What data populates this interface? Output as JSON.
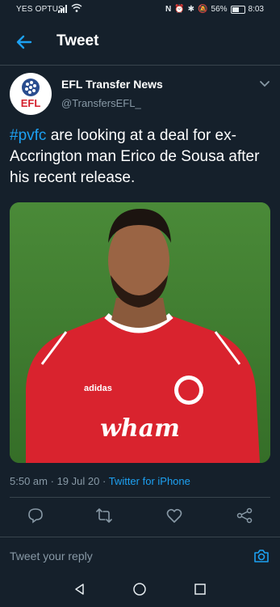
{
  "status_bar": {
    "carrier": "YES OPTUS",
    "battery": "56%",
    "time": "8:03"
  },
  "header": {
    "title": "Tweet"
  },
  "author": {
    "avatar_text": "EFL",
    "name": "EFL Transfer News",
    "handle": "@TransfersEFL_"
  },
  "tweet": {
    "hashtag": "#pvfc",
    "text_after_hashtag": " are looking at a deal for ex-Accrington man Erico de Sousa after his recent release.",
    "photo_shirt_text": "wham",
    "photo_brand_text": "adidas",
    "time": "5:50 am",
    "date": "19 Jul 20",
    "source": "Twitter for iPhone"
  },
  "actions": [
    "reply-icon",
    "retweet-icon",
    "like-icon",
    "share-icon"
  ],
  "reply": {
    "placeholder": "Tweet your reply"
  },
  "colors": {
    "background": "#15202b",
    "accent": "#1da1f2",
    "muted": "#8899a6",
    "divider": "#38444d"
  }
}
